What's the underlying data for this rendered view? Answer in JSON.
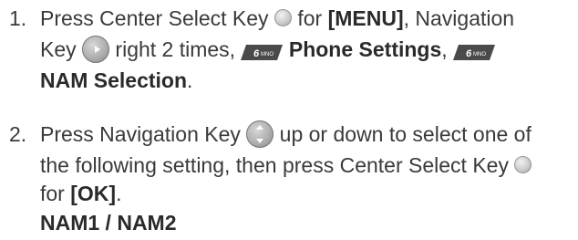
{
  "step1": {
    "number": "1.",
    "t1": "Press Center Select Key",
    "menu": "[MENU]",
    "t2": ", Navigation",
    "t3": "Key",
    "t4": "right 2 times,",
    "key6_label": "6",
    "key6_sub": "MNO",
    "phone_settings": "Phone Settings",
    "comma": ",",
    "nam_selection": "NAM Selection",
    "period": "."
  },
  "step2": {
    "number": "2.",
    "t1": "Press Navigation Key",
    "t2": "up or down to select one of",
    "t3": "the following setting, then press Center Select Key",
    "t4": "for",
    "ok": "[OK]",
    "period": ".",
    "options": "NAM1 / NAM2"
  },
  "icons": {
    "center_select": "center-select-key-icon",
    "nav_right": "navigation-right-key-icon",
    "nav_updown": "navigation-up-down-key-icon",
    "key6": "6mno-key-icon"
  }
}
